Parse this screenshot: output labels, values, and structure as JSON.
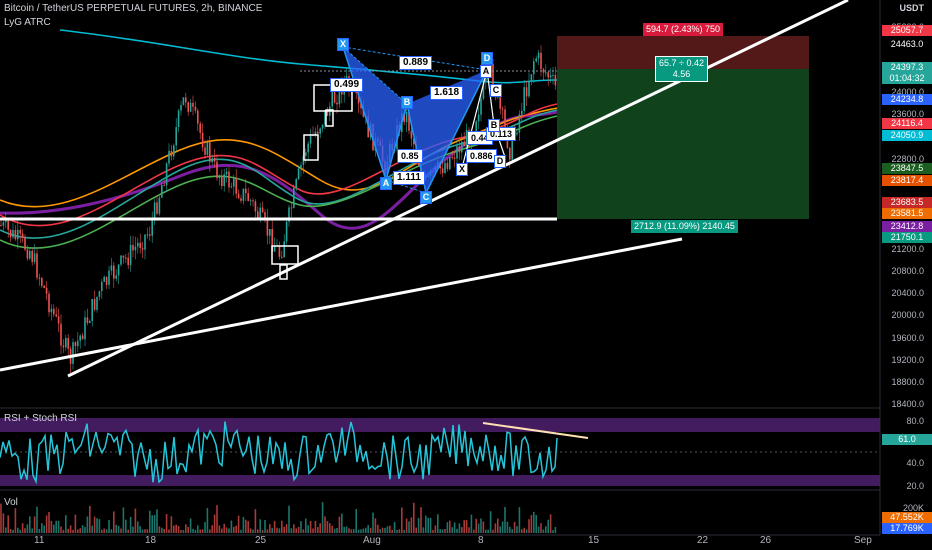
{
  "header": {
    "title": "Bitcoin / TetherUS PERPETUAL FUTURES, 2h, BINANCE",
    "indicator": "LyG ATRC"
  },
  "price_axis": {
    "currency": "USDT",
    "ticks": [
      "25200.0",
      "24463.0",
      "24000.0",
      "23600.0",
      "22800.0",
      "22400.0",
      "22000.0",
      "21200.0",
      "20800.0",
      "20400.0",
      "20000.0",
      "19600.0",
      "19200.0",
      "18800.0",
      "18400.0"
    ],
    "tags": [
      {
        "label": "25057.7",
        "color": "#f23645"
      },
      {
        "label": "24463.0",
        "color": "#000000"
      },
      {
        "label": "24397.3",
        "color": "#26a69a"
      },
      {
        "label": "01:04:32",
        "color": "#26a69a"
      },
      {
        "label": "24234.8",
        "color": "#2962ff"
      },
      {
        "label": "24116.4",
        "color": "#f23645"
      },
      {
        "label": "24050.9",
        "color": "#00bcd4"
      },
      {
        "label": "23847.5",
        "color": "#1b5e20"
      },
      {
        "label": "23817.4",
        "color": "#e65100"
      },
      {
        "label": "23683.5",
        "color": "#c62828"
      },
      {
        "label": "23581.5",
        "color": "#ef6c00"
      },
      {
        "label": "23412.8",
        "color": "#7b1fa2"
      },
      {
        "label": "21750.1",
        "color": "#089981"
      }
    ]
  },
  "time_axis": {
    "labels": [
      "11",
      "18",
      "25",
      "Aug",
      "8",
      "15",
      "22",
      "26",
      "Sep"
    ]
  },
  "position": {
    "target_label": "594.7 (2.43%) 750",
    "rr_label_1": "65.7 ÷ 0.42",
    "rr_label_2": "4.56",
    "stop_label": "2712.9 (11.09%) 2140.45"
  },
  "harmonic": {
    "ratios": [
      "0.499",
      "0.889",
      "1.618",
      "1.111",
      "0.886"
    ],
    "small_ratios": [
      "0.44",
      "0.113",
      "0.85",
      "0.886"
    ],
    "points_big": [
      "X",
      "A",
      "B",
      "C",
      "D"
    ],
    "points_small": [
      "X",
      "A",
      "B",
      "C",
      "D"
    ]
  },
  "rsi_panel": {
    "title": "RSI + Stoch RSI",
    "ticks": [
      "80.0",
      "40.0",
      "20.0"
    ],
    "value_tag": "61.0"
  },
  "vol_panel": {
    "title": "Vol",
    "ticks": [
      "200K"
    ],
    "tags": [
      {
        "label": "47.552K",
        "color": "#ef6c00"
      },
      {
        "label": "17.769K",
        "color": "#2962ff"
      }
    ]
  }
}
